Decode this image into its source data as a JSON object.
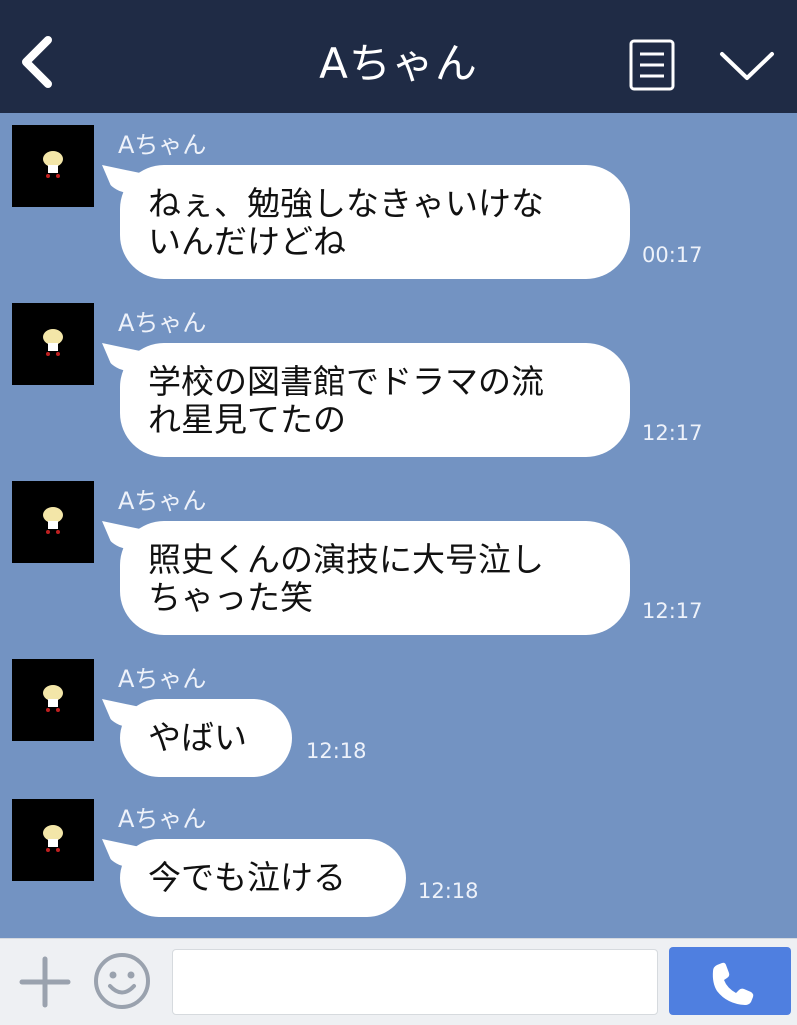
{
  "header": {
    "title": "Aちゃん"
  },
  "messages": [
    {
      "sender": "Aちゃん",
      "lines": [
        "ねぇ、勉強しなきゃいけな",
        "いんだけどね"
      ],
      "time": "00:17"
    },
    {
      "sender": "Aちゃん",
      "lines": [
        "学校の図書館でドラマの流",
        "れ星見てたの"
      ],
      "time": "12:17"
    },
    {
      "sender": "Aちゃん",
      "lines": [
        "照史くんの演技に大号泣し",
        "ちゃった笑"
      ],
      "time": "12:17"
    },
    {
      "sender": "Aちゃん",
      "lines": [
        "やばい"
      ],
      "time": "12:18"
    },
    {
      "sender": "Aちゃん",
      "lines": [
        "今でも泣ける"
      ],
      "time": "12:18"
    }
  ],
  "composer": {
    "value": "",
    "placeholder": ""
  },
  "colors": {
    "header_bg": "#1f2b45",
    "chat_bg": "#7393c2",
    "bubble_bg": "#ffffff",
    "send_button": "#4f7fe0"
  },
  "icons": [
    "back-icon",
    "menu-icon",
    "chevron-down-icon",
    "plus-icon",
    "smiley-icon",
    "phone-icon"
  ]
}
